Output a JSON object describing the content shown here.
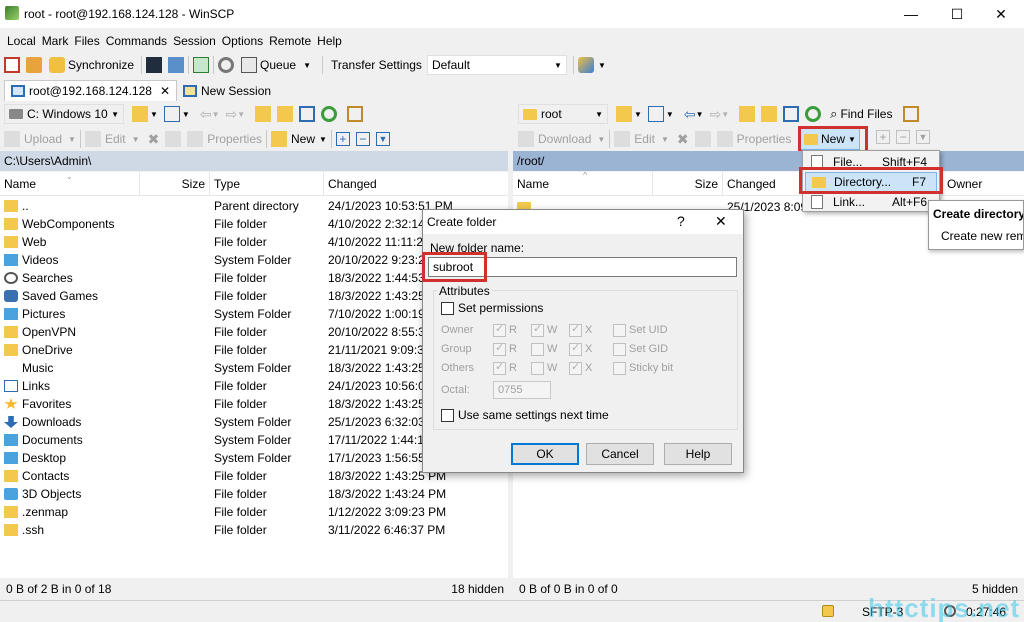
{
  "window": {
    "title": "root - root@192.168.124.128 - WinSCP"
  },
  "menu": [
    "Local",
    "Mark",
    "Files",
    "Commands",
    "Session",
    "Options",
    "Remote",
    "Help"
  ],
  "toolbar": {
    "synchronize": "Synchronize",
    "queue": "Queue",
    "transfer_settings_label": "Transfer Settings",
    "transfer_settings_value": "Default"
  },
  "tabs": {
    "session": "root@192.168.124.128",
    "new_session": "New Session"
  },
  "left": {
    "drive": "C: Windows 10",
    "upload": "Upload",
    "edit": "Edit",
    "properties": "Properties",
    "new": "New",
    "path": "C:\\Users\\Admin\\",
    "columns": {
      "name": "Name",
      "size": "Size",
      "type": "Type",
      "changed": "Changed"
    },
    "rows": [
      {
        "name": "..",
        "type": "Parent directory",
        "changed": "24/1/2023 10:53:51 PM",
        "kind": "up"
      },
      {
        "name": "WebComponents",
        "type": "File folder",
        "changed": "4/10/2022 2:32:14 PM",
        "kind": "folder"
      },
      {
        "name": "Web",
        "type": "File folder",
        "changed": "4/10/2022 11:11:2",
        "kind": "folder"
      },
      {
        "name": "Videos",
        "type": "System Folder",
        "changed": "20/10/2022 9:23:2",
        "kind": "sys"
      },
      {
        "name": "Searches",
        "type": "File folder",
        "changed": "18/3/2022 1:44:53",
        "kind": "search"
      },
      {
        "name": "Saved Games",
        "type": "File folder",
        "changed": "18/3/2022 1:43:25",
        "kind": "games"
      },
      {
        "name": "Pictures",
        "type": "System Folder",
        "changed": "7/10/2022 1:00:19",
        "kind": "sys"
      },
      {
        "name": "OpenVPN",
        "type": "File folder",
        "changed": "20/10/2022 8:55:3",
        "kind": "folder"
      },
      {
        "name": "OneDrive",
        "type": "File folder",
        "changed": "21/11/2021 9:09:3",
        "kind": "folder"
      },
      {
        "name": "Music",
        "type": "System Folder",
        "changed": "18/3/2022 1:43:25",
        "kind": "music"
      },
      {
        "name": "Links",
        "type": "File folder",
        "changed": "24/1/2023 10:56:0",
        "kind": "links"
      },
      {
        "name": "Favorites",
        "type": "File folder",
        "changed": "18/3/2022 1:43:25",
        "kind": "star"
      },
      {
        "name": "Downloads",
        "type": "System Folder",
        "changed": "25/1/2023 6:32:03",
        "kind": "down"
      },
      {
        "name": "Documents",
        "type": "System Folder",
        "changed": "17/11/2022 1:44:1",
        "kind": "sys"
      },
      {
        "name": "Desktop",
        "type": "System Folder",
        "changed": "17/1/2023 1:56:55",
        "kind": "sys"
      },
      {
        "name": "Contacts",
        "type": "File folder",
        "changed": "18/3/2022 1:43:25 PM",
        "kind": "contacts"
      },
      {
        "name": "3D Objects",
        "type": "File folder",
        "changed": "18/3/2022 1:43:24 PM",
        "kind": "obj3d"
      },
      {
        "name": ".zenmap",
        "type": "File folder",
        "changed": "1/12/2022 3:09:23 PM",
        "kind": "folder"
      },
      {
        "name": ".ssh",
        "type": "File folder",
        "changed": "3/11/2022 6:46:37 PM",
        "kind": "folder"
      }
    ],
    "status_left": "0 B of 2 B in 0 of 18",
    "status_right": "18 hidden"
  },
  "right": {
    "folder": "root",
    "find_files": "Find Files",
    "download": "Download",
    "edit": "Edit",
    "properties": "Properties",
    "new": "New",
    "path": "/root/",
    "columns": {
      "name": "Name",
      "size": "Size",
      "changed": "Changed",
      "owner": "Owner"
    },
    "first_changed": "25/1/2023 8:09",
    "status_left": "0 B of 0 B in 0 of 0",
    "status_right": "5 hidden"
  },
  "new_menu": {
    "items": [
      {
        "label": "File...",
        "shortcut": "Shift+F4"
      },
      {
        "label": "Directory...",
        "shortcut": "F7"
      },
      {
        "label": "Link...",
        "shortcut": "Alt+F6"
      }
    ]
  },
  "tooltip": {
    "title": "Create directory",
    "desc": "Create new remo"
  },
  "dialog": {
    "title": "Create folder",
    "help_icon": "?",
    "name_label": "New folder name:",
    "name_value": "subroot",
    "attributes_label": "Attributes",
    "set_permissions": "Set permissions",
    "owner": "Owner",
    "group": "Group",
    "others": "Others",
    "r": "R",
    "w": "W",
    "x": "X",
    "set_uid": "Set UID",
    "set_gid": "Set GID",
    "sticky_bit": "Sticky bit",
    "octal_label": "Octal:",
    "octal_value": "0755",
    "same_settings": "Use same settings next time",
    "ok": "OK",
    "cancel": "Cancel",
    "help": "Help"
  },
  "bottom_status": {
    "protocol": "SFTP-3",
    "time": "0:27:46"
  },
  "watermark": "httctips.net"
}
